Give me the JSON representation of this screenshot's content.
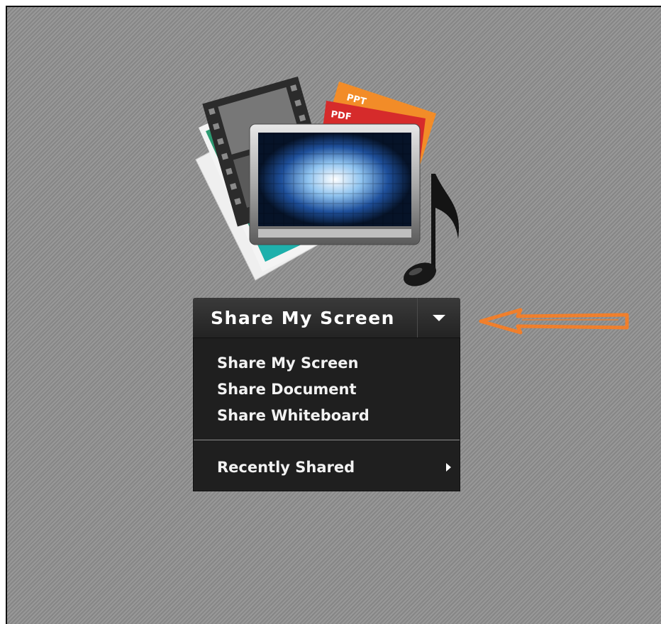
{
  "share_button": {
    "label": "Share My Screen",
    "dropdown_icon": "chevron-down-icon"
  },
  "share_menu": {
    "items": [
      {
        "label": "Share My Screen"
      },
      {
        "label": "Share Document"
      },
      {
        "label": "Share Whiteboard"
      }
    ],
    "recent": {
      "label": "Recently Shared",
      "icon": "chevron-right-icon"
    }
  },
  "illustration": {
    "tags": [
      "PPT",
      "PDF"
    ],
    "icon": "media-share-icon"
  },
  "annotation": {
    "icon": "left-arrow-annotation",
    "color": "#f07f2c"
  },
  "colors": {
    "background": "#8e8e8e",
    "menu_background": "#1f1f1f",
    "text": "#ffffff",
    "ppt_tag": "#f28c28",
    "pdf_tag": "#d62b2b"
  }
}
